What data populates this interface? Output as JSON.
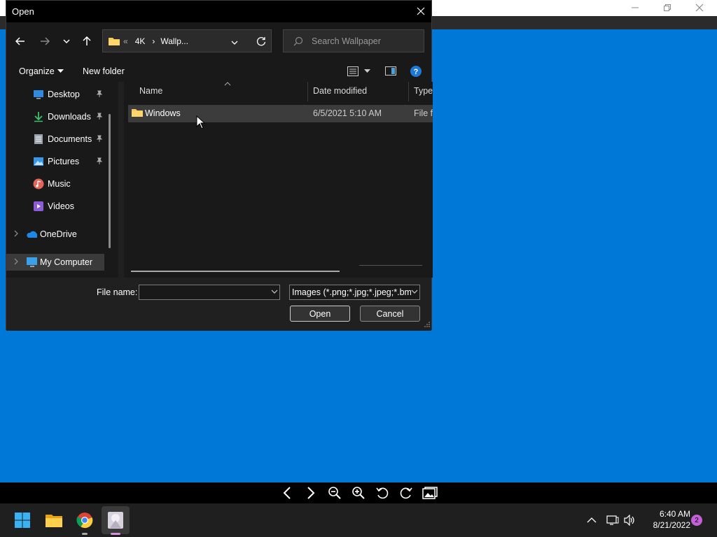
{
  "dialog": {
    "title": "Open",
    "address": {
      "overflow": "«",
      "segments": [
        "4K",
        "Wallp..."
      ]
    },
    "search_placeholder": "Search Wallpaper",
    "toolbar": {
      "organize_label": "Organize",
      "new_folder_label": "New folder"
    },
    "nav_items": [
      {
        "label": "Desktop",
        "icon": "desktop-icon",
        "pinned": true
      },
      {
        "label": "Downloads",
        "icon": "download-icon",
        "pinned": true
      },
      {
        "label": "Documents",
        "icon": "documents-icon",
        "pinned": true
      },
      {
        "label": "Pictures",
        "icon": "pictures-icon",
        "pinned": true
      },
      {
        "label": "Music",
        "icon": "music-icon",
        "pinned": false
      },
      {
        "label": "Videos",
        "icon": "videos-icon",
        "pinned": false
      },
      {
        "label": "OneDrive",
        "icon": "onedrive-icon",
        "pinned": false
      },
      {
        "label": "My Computer",
        "icon": "computer-icon",
        "pinned": false
      }
    ],
    "columns": {
      "name": "Name",
      "date": "Date modified",
      "type": "Type"
    },
    "files": [
      {
        "name": "Windows",
        "date": "6/5/2021 5:10 AM",
        "type": "File fo"
      }
    ],
    "file_name_label": "File name:",
    "file_name_value": "",
    "filter_value": "Images (*.png;*.jpg;*.jpeg;*.bm",
    "open_label": "Open",
    "cancel_label": "Cancel"
  },
  "taskbar": {
    "time": "6:40 AM",
    "date": "8/21/2022",
    "notification_count": "2"
  },
  "colors": {
    "desktop_blue": "#0078d7",
    "accent": "#4aa3df"
  }
}
